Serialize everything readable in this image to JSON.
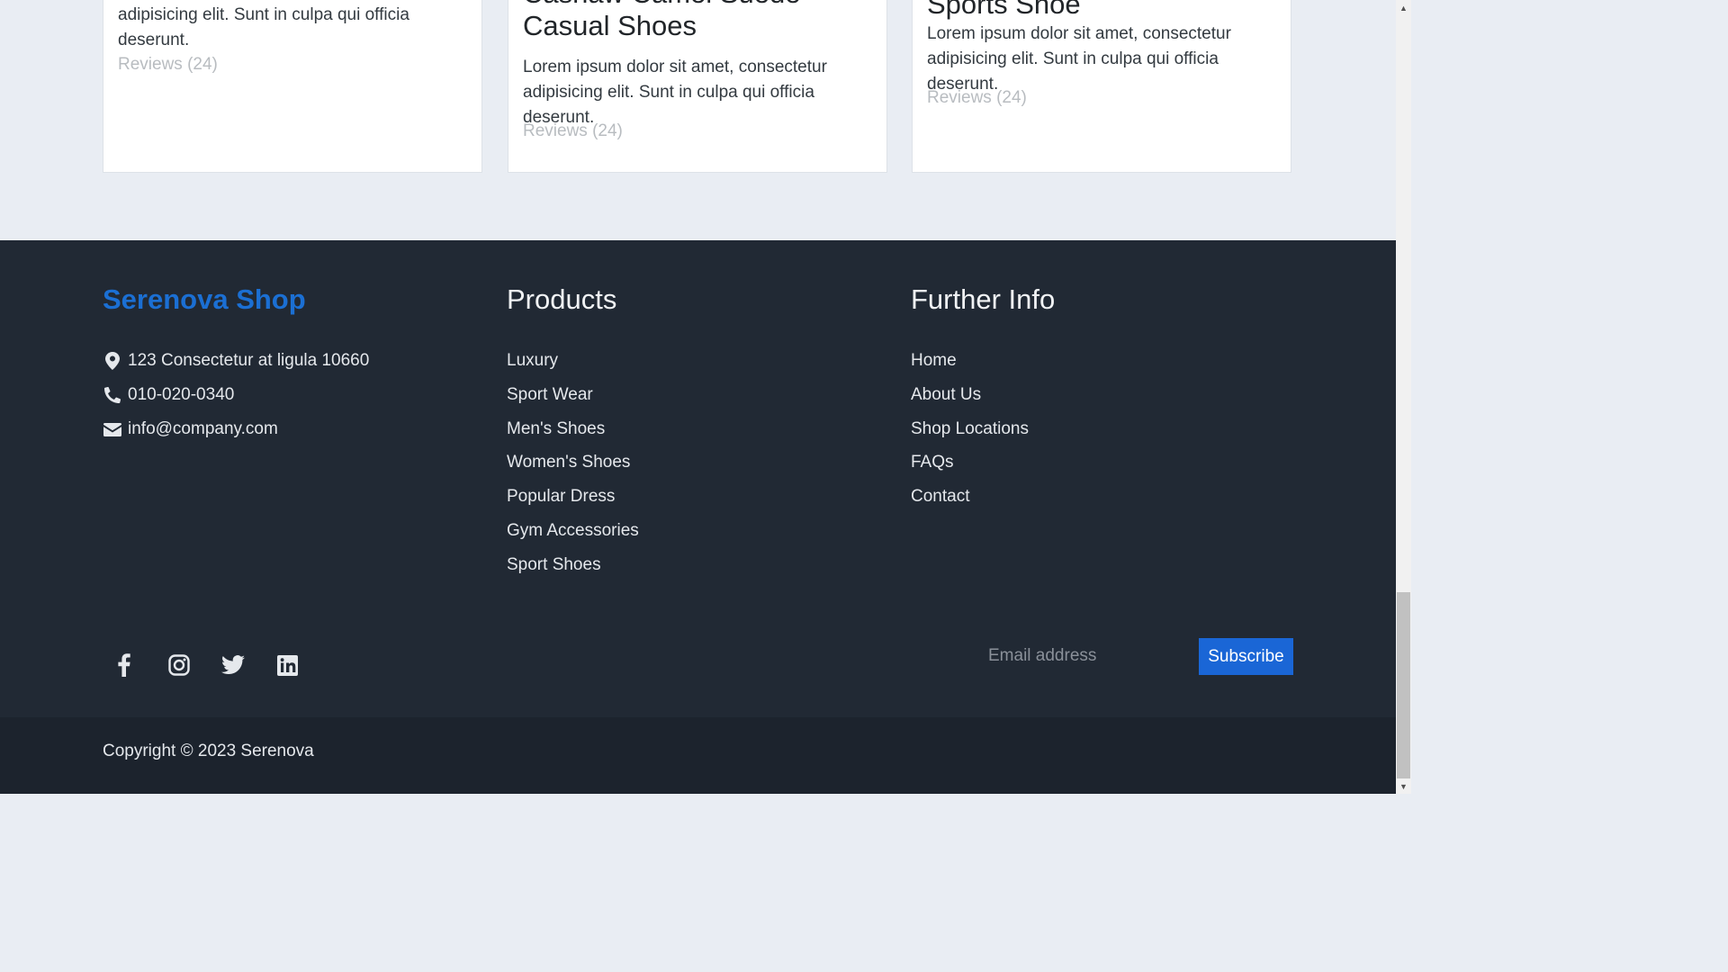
{
  "products": [
    {
      "title": "",
      "desc": "Lorem ipsum dolor sit amet, consectetur adipisicing elit. Sunt in culpa qui officia deserunt.",
      "reviews": "Reviews (24)"
    },
    {
      "title": "Cashaw Camel Suede Casual Shoes",
      "desc": "Lorem ipsum dolor sit amet, consectetur adipisicing elit. Sunt in culpa qui officia deserunt.",
      "reviews": "Reviews (24)"
    },
    {
      "title": "Sports Shoe",
      "desc": "Lorem ipsum dolor sit amet, consectetur adipisicing elit. Sunt in culpa qui officia deserunt.",
      "reviews": "Reviews (24)"
    }
  ],
  "footer": {
    "brand": "Serenova Shop",
    "brand_color": "#1b6fd3",
    "contact": {
      "address": "123 Consectetur at ligula 10660",
      "phone": "010-020-0340",
      "email": "info@company.com"
    },
    "products_title": "Products",
    "products_links": [
      "Luxury",
      "Sport Wear",
      "Men's Shoes",
      "Women's Shoes",
      "Popular Dress",
      "Gym Accessories",
      "Sport Shoes"
    ],
    "info_title": "Further Info",
    "info_links": [
      "Home",
      "About Us",
      "Shop Locations",
      "FAQs",
      "Contact"
    ],
    "social_icons": [
      "facebook-icon",
      "instagram-icon",
      "twitter-icon",
      "linkedin-icon"
    ],
    "subscribe": {
      "placeholder": "Email address",
      "button_label": "Subscribe",
      "button_color": "#1a66d6"
    },
    "copyright": "Copyright © 2023 Serenova"
  }
}
